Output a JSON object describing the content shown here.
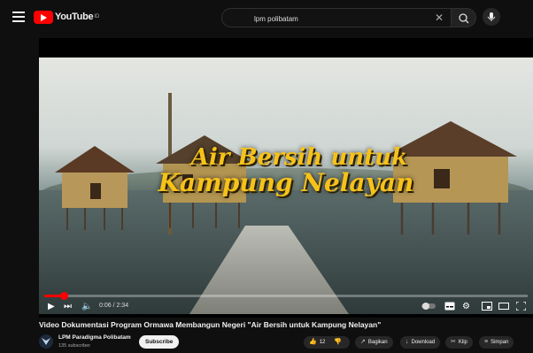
{
  "header": {
    "logo_text": "YouTube",
    "logo_suffix": "ID",
    "search_value": "lpm polibatam"
  },
  "player": {
    "overlay_line1": "Air Bersih untuk",
    "overlay_line2": "Kampung Nelayan",
    "time": "0:06 / 2:34",
    "progress": 0.04
  },
  "video": {
    "title": "Video Dokumentasi Program Ormawa Membangun Negeri \"Air Bersih untuk Kampung Nelayan\"",
    "channel": "LPM Paradigma Polibatam",
    "subscribers": "135 subscriber",
    "subscribe_label": "Subscribe",
    "likes": "12",
    "share_label": "Bagikan",
    "download_label": "Download",
    "clip_label": "Klip",
    "save_label": "Simpan"
  },
  "colors": {
    "accent": "#ff0000",
    "overlay_text": "#f6c21a",
    "background": "#0f0f0f"
  }
}
